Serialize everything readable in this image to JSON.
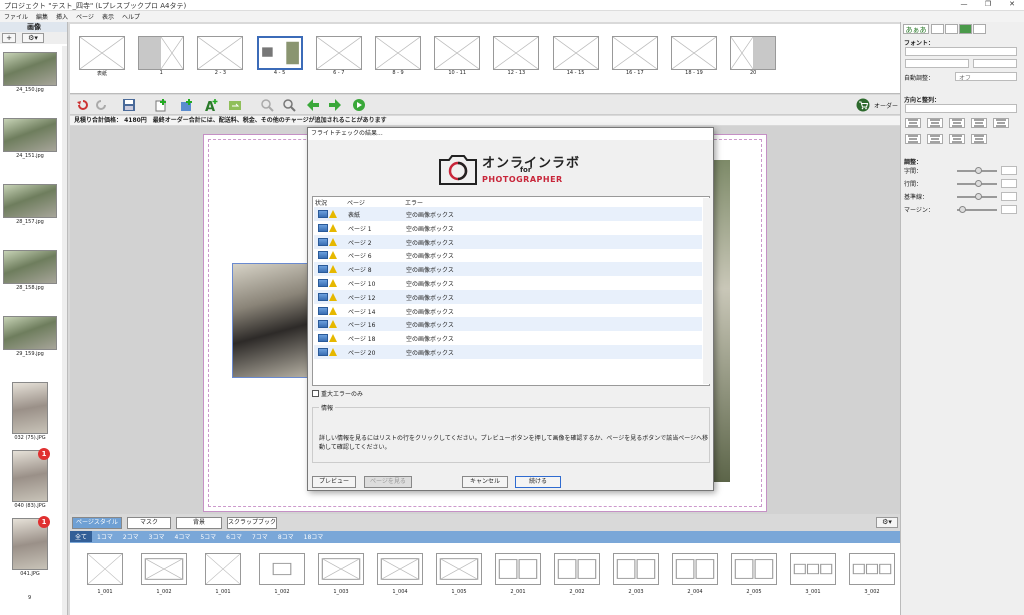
{
  "window": {
    "title": "プロジェクト \"テスト_四寺\" (Lプレスブックプロ A4タテ)"
  },
  "menu": [
    "ファイル",
    "編集",
    "挿入",
    "ページ",
    "表示",
    "ヘルプ"
  ],
  "left_panel": {
    "header": "画像",
    "add_label": "+",
    "images": [
      {
        "name": "24_150.jpg",
        "orient": "land",
        "badge": ""
      },
      {
        "name": "24_151.jpg",
        "orient": "land",
        "badge": ""
      },
      {
        "name": "28_157.jpg",
        "orient": "land",
        "badge": ""
      },
      {
        "name": "28_158.jpg",
        "orient": "land",
        "badge": ""
      },
      {
        "name": "29_159.jpg",
        "orient": "land",
        "badge": ""
      },
      {
        "name": "032 (75).JPG",
        "orient": "port",
        "badge": ""
      },
      {
        "name": "040 (83).JPG",
        "orient": "port",
        "badge": "1"
      },
      {
        "name": "041.JPG",
        "orient": "port",
        "badge": "1"
      }
    ],
    "count": "9"
  },
  "pages": [
    {
      "label": "表紙",
      "type": "cover"
    },
    {
      "label": "1",
      "type": "half-grey"
    },
    {
      "label": "2 - 3",
      "type": "empty"
    },
    {
      "label": "4 - 5",
      "type": "selected"
    },
    {
      "label": "6 - 7",
      "type": "empty"
    },
    {
      "label": "8 - 9",
      "type": "empty"
    },
    {
      "label": "10 - 11",
      "type": "empty"
    },
    {
      "label": "12 - 13",
      "type": "empty"
    },
    {
      "label": "14 - 15",
      "type": "empty"
    },
    {
      "label": "16 - 17",
      "type": "empty"
    },
    {
      "label": "18 - 19",
      "type": "empty"
    },
    {
      "label": "20",
      "type": "half-grey-right"
    }
  ],
  "toolbar": {
    "order_label": "オーダー"
  },
  "price_bar": "見積り合計価格： 4180円　最終オーダー合計には、配送料、税金、その他のチャージが追加されることがあります",
  "bottom_tabs": [
    "ページスタイル",
    "マスク",
    "背景",
    "スクラップブック"
  ],
  "category_tabs": [
    "全て",
    "1コマ",
    "2コマ",
    "3コマ",
    "4コマ",
    "5コマ",
    "6コマ",
    "7コマ",
    "8コマ",
    "18コマ"
  ],
  "layouts": [
    "1_001",
    "1_002",
    "1_001",
    "1_002",
    "1_003",
    "1_004",
    "1_005",
    "2_001",
    "2_002",
    "2_003",
    "2_004",
    "2_005",
    "3_001",
    "3_002"
  ],
  "right_panel": {
    "font_label": "フォント：",
    "auto_adjust_label": "自動調整：",
    "auto_adjust_value": "オフ",
    "direction_label": "方向と整列：",
    "adjust_label": "調整：",
    "adjust_items": [
      "字間：",
      "行間：",
      "基準線：",
      "マージン："
    ]
  },
  "dialog": {
    "title": "フライトチェックの結果...",
    "logo_main": "オンラインラボ",
    "logo_for": "for",
    "logo_sub": "PHOTOGRAPHER",
    "col_status": "状況",
    "col_page": "ページ",
    "col_error": "エラー",
    "rows": [
      {
        "page": "表紙",
        "error": "空の画像ボックス"
      },
      {
        "page": "ページ 1",
        "error": "空の画像ボックス"
      },
      {
        "page": "ページ 2",
        "error": "空の画像ボックス"
      },
      {
        "page": "ページ 6",
        "error": "空の画像ボックス"
      },
      {
        "page": "ページ 8",
        "error": "空の画像ボックス"
      },
      {
        "page": "ページ 10",
        "error": "空の画像ボックス"
      },
      {
        "page": "ページ 12",
        "error": "空の画像ボックス"
      },
      {
        "page": "ページ 14",
        "error": "空の画像ボックス"
      },
      {
        "page": "ページ 16",
        "error": "空の画像ボックス"
      },
      {
        "page": "ページ 18",
        "error": "空の画像ボックス"
      },
      {
        "page": "ページ 20",
        "error": "空の画像ボックス"
      }
    ],
    "major_only": "重大エラーのみ",
    "info_label": "情報",
    "info_text": "詳しい情報を見るにはリストの行をクリックしてください。プレビューボタンを押して画像を確認するか、ページを見るボタンで該当ページへ移動して確認してください。",
    "btn_preview": "プレビュー",
    "btn_view_page": "ページを見る",
    "btn_cancel": "キャンセル",
    "btn_continue": "続ける"
  }
}
